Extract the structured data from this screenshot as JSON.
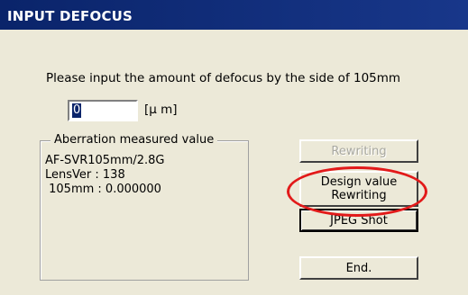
{
  "window": {
    "title": "INPUT DEFOCUS",
    "titlebar_color": "#0a246a",
    "background_color": "#ece9d8"
  },
  "prompt": {
    "text": "Please input the amount of defocus by the side of  105mm"
  },
  "defocus_input": {
    "value": "0",
    "unit_label": "[μ m]"
  },
  "aberration_group": {
    "legend": "Aberration measured value",
    "lines": [
      "AF-SVR105mm/2.8G",
      "LensVer : 138",
      " 105mm : 0.000000"
    ]
  },
  "buttons": {
    "rewriting": "Rewriting",
    "design_value_line1": "Design value",
    "design_value_line2": "Rewriting",
    "jpeg_shot": "JPEG Shot",
    "end": "End."
  },
  "annotation": {
    "highlight_color": "#e21a1a",
    "highlight_target": "design-value-rewriting-button"
  }
}
